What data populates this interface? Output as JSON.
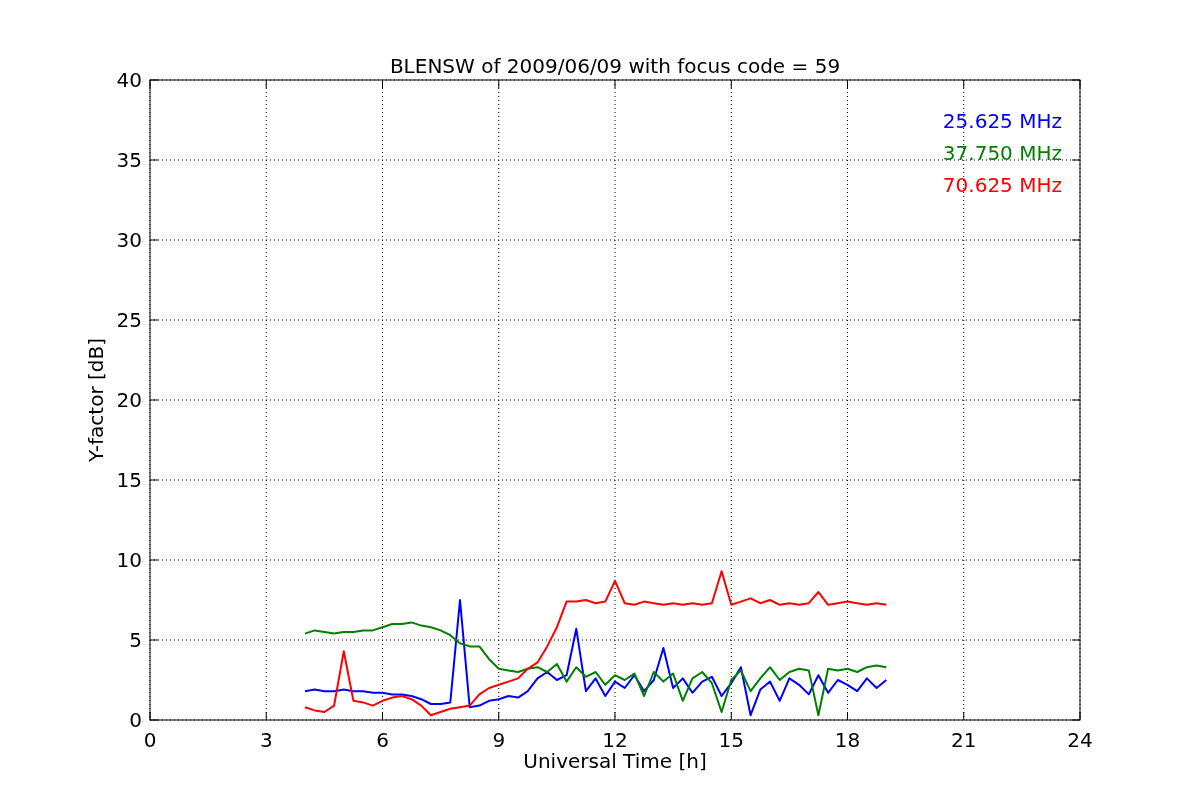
{
  "chart_data": {
    "type": "line",
    "title": "BLENSW of 2009/06/09 with focus code = 59",
    "xlabel": "Universal Time [h]",
    "ylabel": "Y-factor [dB]",
    "x": [
      4,
      4.25,
      4.5,
      4.75,
      5,
      5.25,
      5.5,
      5.75,
      6,
      6.25,
      6.5,
      6.75,
      7,
      7.25,
      7.5,
      7.75,
      8,
      8.25,
      8.5,
      8.75,
      9,
      9.25,
      9.5,
      9.75,
      10,
      10.25,
      10.5,
      10.75,
      11,
      11.25,
      11.5,
      11.75,
      12,
      12.25,
      12.5,
      12.75,
      13,
      13.25,
      13.5,
      13.75,
      14,
      14.25,
      14.5,
      14.75,
      15,
      15.25,
      15.5,
      15.75,
      16,
      16.25,
      16.5,
      16.75,
      17,
      17.25,
      17.5,
      17.75,
      18,
      18.25,
      18.5,
      18.75,
      19
    ],
    "series": [
      {
        "name": "25.625 MHz",
        "color": "#0000ff",
        "values": [
          1.8,
          1.9,
          1.8,
          1.8,
          1.9,
          1.8,
          1.8,
          1.7,
          1.7,
          1.6,
          1.6,
          1.5,
          1.3,
          1.0,
          1.0,
          1.1,
          7.5,
          0.8,
          0.9,
          1.2,
          1.3,
          1.5,
          1.4,
          1.8,
          2.6,
          3.0,
          2.5,
          2.8,
          5.7,
          1.8,
          2.6,
          1.5,
          2.4,
          2.0,
          2.8,
          1.8,
          2.5,
          4.5,
          2.0,
          2.6,
          1.7,
          2.4,
          2.7,
          1.5,
          2.3,
          3.3,
          0.3,
          1.9,
          2.4,
          1.2,
          2.6,
          2.2,
          1.6,
          2.8,
          1.7,
          2.5,
          2.2,
          1.8,
          2.6,
          2.0,
          2.5
        ]
      },
      {
        "name": "37.750 MHz",
        "color": "#008000",
        "values": [
          5.4,
          5.6,
          5.5,
          5.4,
          5.5,
          5.5,
          5.6,
          5.6,
          5.8,
          6.0,
          6.0,
          6.1,
          5.9,
          5.8,
          5.6,
          5.3,
          4.8,
          4.6,
          4.6,
          3.8,
          3.2,
          3.1,
          3.0,
          3.2,
          3.3,
          3.0,
          3.5,
          2.4,
          3.3,
          2.7,
          3.0,
          2.2,
          2.8,
          2.5,
          2.9,
          1.5,
          3.0,
          2.4,
          2.9,
          1.2,
          2.6,
          3.0,
          2.3,
          0.5,
          2.5,
          3.1,
          1.8,
          2.6,
          3.3,
          2.5,
          3.0,
          3.2,
          3.1,
          0.3,
          3.2,
          3.1,
          3.2,
          3.0,
          3.3,
          3.4,
          3.3
        ]
      },
      {
        "name": "70.625 MHz",
        "color": "#ff0000",
        "values": [
          0.8,
          0.6,
          0.5,
          0.9,
          4.3,
          1.2,
          1.1,
          0.9,
          1.2,
          1.4,
          1.5,
          1.3,
          0.9,
          0.3,
          0.5,
          0.7,
          0.8,
          0.9,
          1.6,
          2.0,
          2.2,
          2.4,
          2.6,
          3.2,
          3.6,
          4.6,
          5.8,
          7.4,
          7.4,
          7.5,
          7.3,
          7.4,
          8.7,
          7.3,
          7.2,
          7.4,
          7.3,
          7.2,
          7.3,
          7.2,
          7.3,
          7.2,
          7.3,
          9.3,
          7.2,
          7.4,
          7.6,
          7.3,
          7.5,
          7.2,
          7.3,
          7.2,
          7.3,
          8.0,
          7.2,
          7.3,
          7.4,
          7.3,
          7.2,
          7.3,
          7.2
        ]
      }
    ],
    "xlim": [
      0,
      24
    ],
    "ylim": [
      0,
      40
    ],
    "xticks": [
      0,
      3,
      6,
      9,
      12,
      15,
      18,
      21,
      24
    ],
    "yticks": [
      0,
      5,
      10,
      15,
      20,
      25,
      30,
      35,
      40
    ],
    "grid": true
  }
}
